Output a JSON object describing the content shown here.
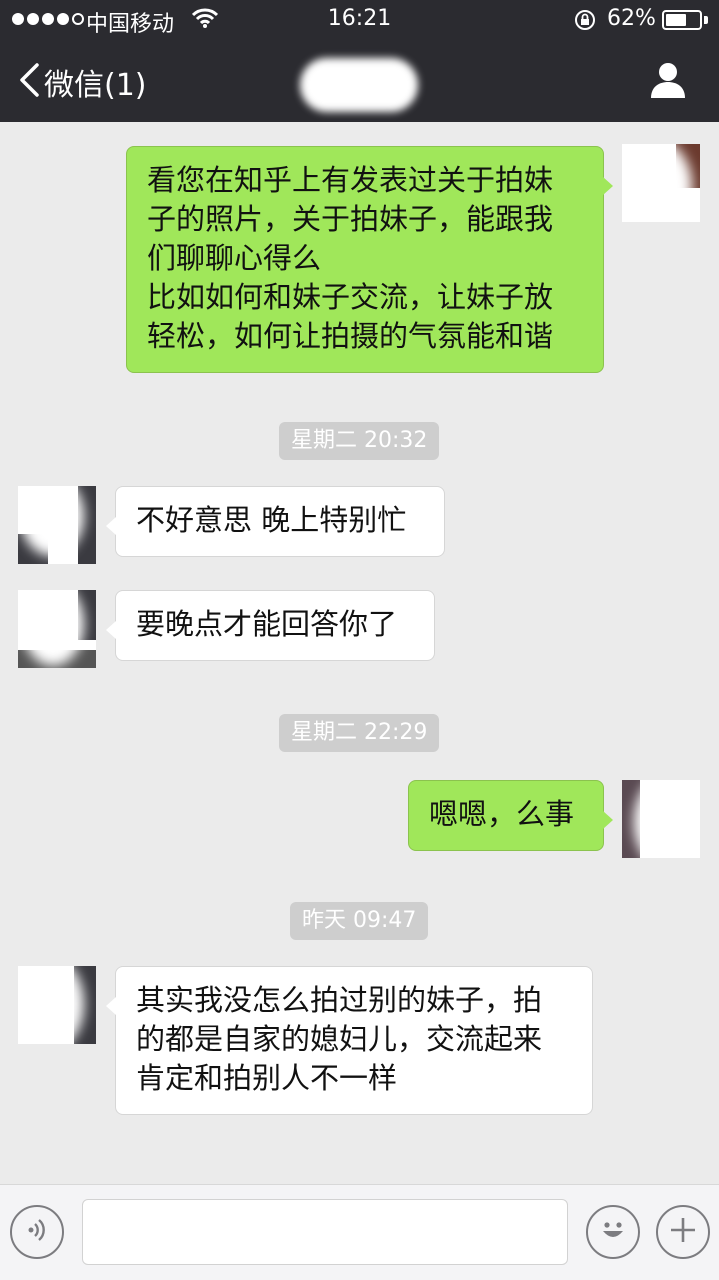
{
  "status_bar": {
    "carrier": "中国移动",
    "time": "16:21",
    "battery_percent": "62%",
    "battery_level": 0.62,
    "signal_bars": 4,
    "signal_max": 5
  },
  "nav": {
    "back_label": "微信(1)",
    "back_icon": "chevron-left-icon",
    "profile_icon": "person-icon"
  },
  "messages": [
    {
      "side": "right",
      "lines": [
        "看您在知乎上有发表过关于拍妹",
        "子的照片，关于拍妹子，能跟我",
        "们聊聊心得么",
        "比如如何和妹子交流，让妹子放",
        "轻松，如何让拍摄的气氛能和谐"
      ]
    },
    {
      "type": "timestamp",
      "text": "星期二 20:32"
    },
    {
      "side": "left",
      "lines": [
        "不好意思 晚上特别忙"
      ]
    },
    {
      "side": "left",
      "lines": [
        "要晚点才能回答你了"
      ]
    },
    {
      "type": "timestamp",
      "text": "星期二 22:29"
    },
    {
      "side": "right",
      "lines": [
        "嗯嗯，么事"
      ]
    },
    {
      "type": "timestamp",
      "text": "昨天 09:47"
    },
    {
      "side": "left",
      "lines": [
        "其实我没怎么拍过别的妹子，拍",
        "的都是自家的媳妇儿，交流起来",
        "肯定和拍别人不一样"
      ]
    }
  ],
  "input_bar": {
    "voice_icon": "voice-icon",
    "emoji_icon": "emoji-icon",
    "plus_icon": "plus-icon",
    "text_value": ""
  },
  "colors": {
    "top_bar": "#2b2b30",
    "chat_background": "#ebebeb",
    "outgoing_bubble": "#a0e75a",
    "incoming_bubble": "#ffffff",
    "timestamp_chip": "#cecece"
  }
}
